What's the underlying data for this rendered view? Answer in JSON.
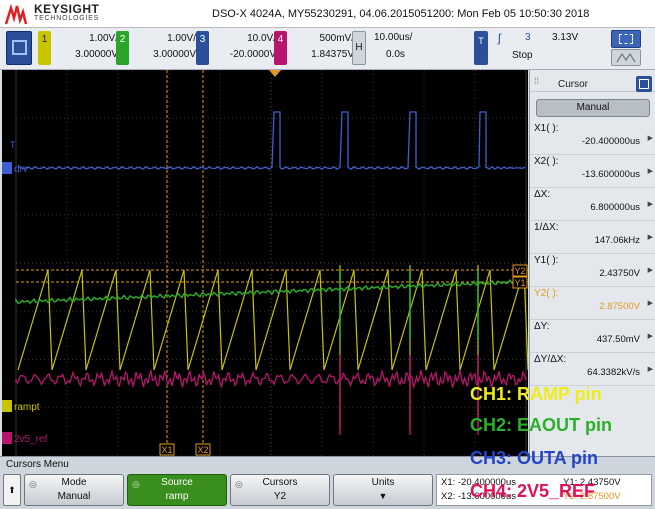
{
  "header": {
    "brand": "KEYSIGHT",
    "brand_sub": "TECHNOLOGIES",
    "instrument_info": "DSO-X 4024A, MY55230291, 04.06.2015051200: Mon Feb 05 10:50:30 2018"
  },
  "channels": [
    {
      "num": "1",
      "scale": "1.00V/",
      "offset": "3.00000V",
      "color": "#c9c400"
    },
    {
      "num": "2",
      "scale": "1.00V/",
      "offset": "3.00000V",
      "color": "#2aa52a"
    },
    {
      "num": "3",
      "scale": "10.0V/",
      "offset": "-20.0000V",
      "color": "#2b4f99"
    },
    {
      "num": "4",
      "scale": "500mV/",
      "offset": "1.84375V",
      "color": "#b8156e"
    }
  ],
  "timebase": {
    "h_label": "H",
    "scale": "10.00us/",
    "delay": "0.0s"
  },
  "trigger": {
    "label": "T",
    "slope": "ʃ",
    "source": "3",
    "level": "3.13V",
    "mode": "Stop"
  },
  "side_panel": {
    "title": "Cursor",
    "mode": "Manual",
    "rows": [
      {
        "label": "X1( ):",
        "value": "-20.400000us",
        "color": "#111"
      },
      {
        "label": "X2( ):",
        "value": "-13.600000us",
        "color": "#111"
      },
      {
        "label": "ΔX:",
        "value": "6.800000us",
        "color": "#111"
      },
      {
        "label": "1/ΔX:",
        "value": "147.06kHz",
        "color": "#111"
      },
      {
        "label": "Y1( ):",
        "value": "2.43750V",
        "color": "#111"
      },
      {
        "label": "Y2( ):",
        "value": "2.87500V",
        "color": "#e39a22"
      },
      {
        "label": "ΔY:",
        "value": "437.50mV",
        "color": "#111"
      },
      {
        "label": "ΔY/ΔX:",
        "value": "64.3382kV/s",
        "color": "#111"
      }
    ]
  },
  "screen_labels": {
    "ch3": "drv",
    "ch1": "rampt",
    "ch4": "2v5_ref",
    "x1": "X1",
    "x2": "X2",
    "y1": "Y1",
    "y2": "Y2",
    "t": "T"
  },
  "bottom": {
    "menu_title": "Cursors Menu",
    "softkeys": [
      {
        "title": "Mode",
        "value": "Manual"
      },
      {
        "title": "Source",
        "value": "ramp"
      },
      {
        "title": "Cursors",
        "value": "Y2"
      },
      {
        "title": "Units",
        "value": "▼"
      }
    ],
    "readout": {
      "x1": "X1: -20.400000us",
      "x2": "X2: -13.600000us",
      "y1": "Y1: 2.43750V",
      "y2": "Y2: 2.87500V"
    }
  },
  "annotations": [
    {
      "text": "CH1: RAMP pin",
      "color": "#f0ec1a"
    },
    {
      "text": "CH2: EAOUT pin",
      "color": "#2ab02a"
    },
    {
      "text": "CH3: OUTA pin",
      "color": "#2545c6"
    },
    {
      "text": "CH4: 2V5_REF",
      "color": "#e0105a"
    }
  ]
}
